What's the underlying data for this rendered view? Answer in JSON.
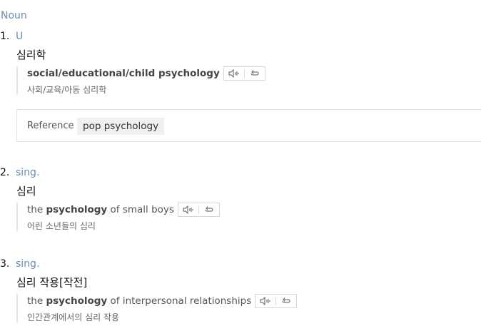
{
  "pos": "Noun",
  "senses": [
    {
      "number": "1.",
      "usage": "U",
      "meaning": "심리학",
      "example": {
        "en": "social/educational/child psychology",
        "ko": "사회/교육/아동 심리학"
      },
      "reference": {
        "label": "Reference",
        "item": "pop psychology"
      }
    },
    {
      "number": "2.",
      "usage": "sing.",
      "meaning": "심리",
      "example": {
        "pre": "the ",
        "keyword": "psychology",
        "post": " of small boys",
        "ko": "어린 소년들의 심리"
      }
    },
    {
      "number": "3.",
      "usage": "sing.",
      "meaning": "심리 작용[작전]",
      "example": {
        "pre": "the ",
        "keyword": "psychology",
        "post": " of interpersonal relationships",
        "ko": "인간관계에서의 심리 작용"
      }
    }
  ],
  "icons": {
    "listen": "speaker-icon",
    "repeat": "repeat-icon"
  }
}
